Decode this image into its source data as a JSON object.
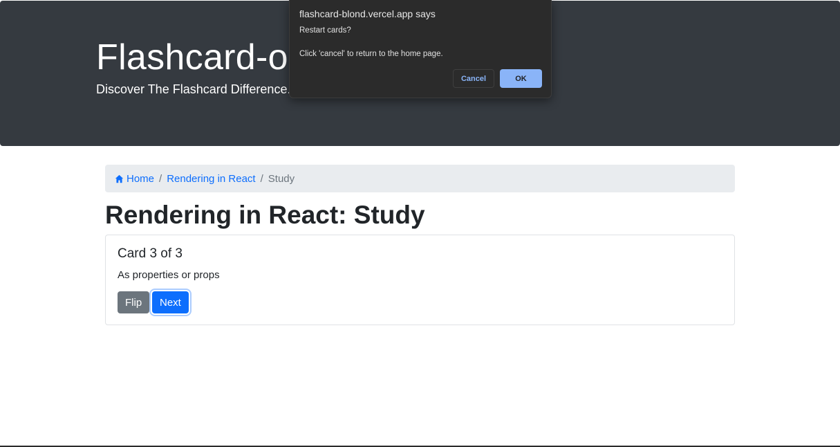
{
  "hero": {
    "title": "Flashcard-o-m",
    "subtitle": "Discover The Flashcard Difference."
  },
  "breadcrumb": {
    "home_icon": "home-icon",
    "home_label": "Home",
    "deck_label": "Rendering in React",
    "current_label": "Study",
    "separator": "/"
  },
  "page": {
    "title": "Rendering in React: Study"
  },
  "card": {
    "title": "Card 3 of 3",
    "text": "As properties or props",
    "flip_label": "Flip",
    "next_label": "Next"
  },
  "dialog": {
    "origin": "flashcard-blond.vercel.app says",
    "line1": "Restart cards?",
    "line2": "Click 'cancel' to return to the home page.",
    "cancel_label": "Cancel",
    "ok_label": "OK"
  },
  "colors": {
    "hero_bg": "#353a40",
    "link": "#0d6efd",
    "primary": "#0d6efd",
    "secondary": "#6c757d",
    "dialog_bg": "#2b2b2b",
    "dialog_accent": "#8ab4f8"
  }
}
